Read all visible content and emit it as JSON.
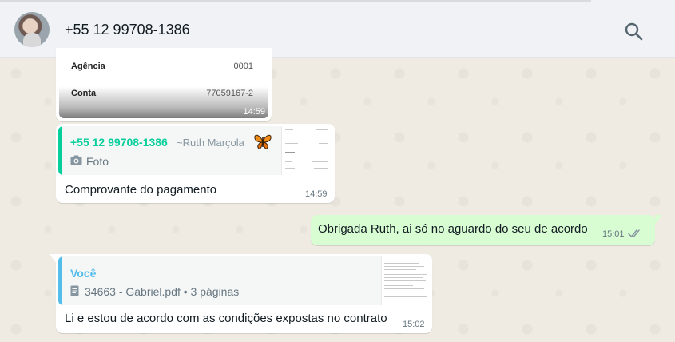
{
  "header": {
    "contact_name": "+55 12 99708-1386",
    "search_icon": "search-icon"
  },
  "messages": [
    {
      "direction": "incoming",
      "type": "image",
      "rows": [
        {
          "label": "Agência",
          "value": "0001"
        },
        {
          "label": "Conta",
          "value": "77059167-2"
        }
      ],
      "time": "14:59"
    },
    {
      "direction": "incoming",
      "type": "reply",
      "quote": {
        "author": "+55 12 99708-1386",
        "push_name": "~Ruth Marçola",
        "emoji_icon": "butterfly-icon",
        "media_icon": "camera-icon",
        "media_label": "Foto"
      },
      "text": "Comprovante do pagamento",
      "time": "14:59"
    },
    {
      "direction": "outgoing",
      "type": "text",
      "text": "Obrigada Ruth, ai só no aguardo do seu de acordo",
      "time": "15:01",
      "status_icon": "double-check-icon"
    },
    {
      "direction": "incoming",
      "type": "reply",
      "quote": {
        "author": "Você",
        "media_icon": "document-icon",
        "media_label": "34663 - Gabriel.pdf • 3 páginas"
      },
      "text": "Li e estou de acordo com as condições expostas no contrato",
      "time": "15:02"
    }
  ],
  "colors": {
    "header_bg": "#f0f2f5",
    "chat_bg": "#efeae2",
    "outgoing_bubble": "#d9fdd3",
    "quote_green": "#06cf9c",
    "quote_blue": "#53bdeb",
    "read_ticks": "#53bdeb"
  }
}
